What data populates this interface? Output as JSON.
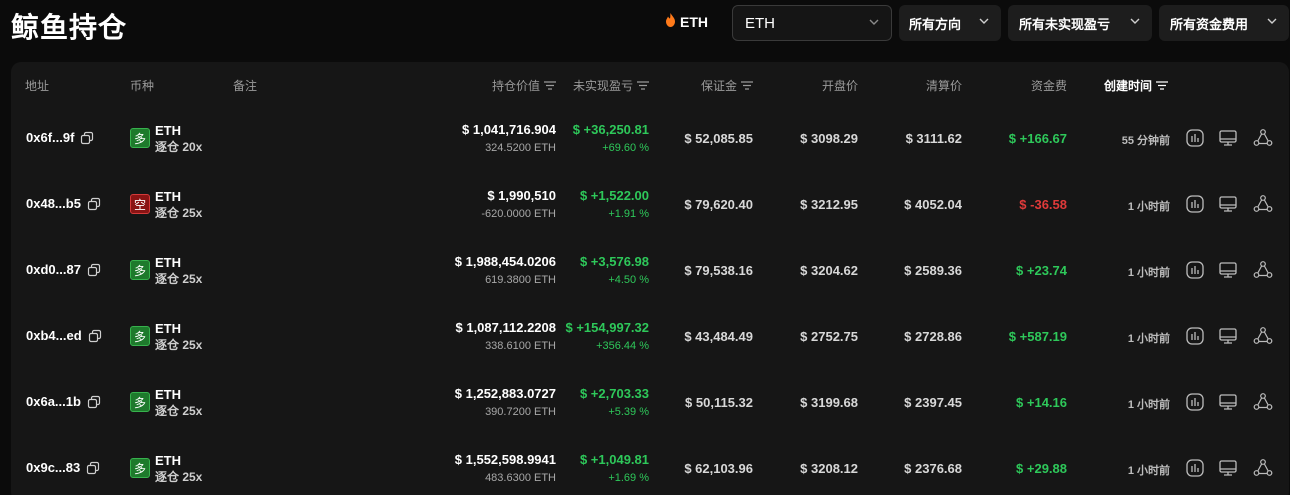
{
  "page": {
    "title": "鲸鱼持仓"
  },
  "filters": {
    "hot_coin": "ETH",
    "coin_select": "ETH",
    "direction": "所有方向",
    "unrealized": "所有未实现盈亏",
    "funding": "所有资金费用"
  },
  "headers": {
    "address": "地址",
    "coin": "币种",
    "note": "备注",
    "position_value": "持仓价值",
    "unrealized_pnl": "未实现盈亏",
    "margin": "保证金",
    "entry_price": "开盘价",
    "liq_price": "清算价",
    "funding_fee": "资金费",
    "created": "创建时间"
  },
  "rows": [
    {
      "address": "0x6f...9f",
      "side": "多",
      "side_type": "long",
      "coin": "ETH",
      "margin_mode": "逐仓 20x",
      "value": "$ 1,041,716.904",
      "size": "324.5200 ETH",
      "pnl": "$ +36,250.81",
      "pnl_pct": "+69.60 %",
      "pnl_sign": "pos",
      "margin": "$ 52,085.85",
      "entry": "$ 3098.29",
      "liq": "$ 3111.62",
      "funding": "$ +166.67",
      "funding_sign": "pos",
      "time": "55 分钟前"
    },
    {
      "address": "0x48...b5",
      "side": "空",
      "side_type": "short",
      "coin": "ETH",
      "margin_mode": "逐仓 25x",
      "value": "$ 1,990,510",
      "size": "-620.0000 ETH",
      "pnl": "$ +1,522.00",
      "pnl_pct": "+1.91 %",
      "pnl_sign": "pos",
      "margin": "$ 79,620.40",
      "entry": "$ 3212.95",
      "liq": "$ 4052.04",
      "funding": "$ -36.58",
      "funding_sign": "neg",
      "time": "1 小时前"
    },
    {
      "address": "0xd0...87",
      "side": "多",
      "side_type": "long",
      "coin": "ETH",
      "margin_mode": "逐仓 25x",
      "value": "$ 1,988,454.0206",
      "size": "619.3800 ETH",
      "pnl": "$ +3,576.98",
      "pnl_pct": "+4.50 %",
      "pnl_sign": "pos",
      "margin": "$ 79,538.16",
      "entry": "$ 3204.62",
      "liq": "$ 2589.36",
      "funding": "$ +23.74",
      "funding_sign": "pos",
      "time": "1 小时前"
    },
    {
      "address": "0xb4...ed",
      "side": "多",
      "side_type": "long",
      "coin": "ETH",
      "margin_mode": "逐仓 25x",
      "value": "$ 1,087,112.2208",
      "size": "338.6100 ETH",
      "pnl": "$ +154,997.32",
      "pnl_pct": "+356.44 %",
      "pnl_sign": "pos",
      "margin": "$ 43,484.49",
      "entry": "$ 2752.75",
      "liq": "$ 2728.86",
      "funding": "$ +587.19",
      "funding_sign": "pos",
      "time": "1 小时前"
    },
    {
      "address": "0x6a...1b",
      "side": "多",
      "side_type": "long",
      "coin": "ETH",
      "margin_mode": "逐仓 25x",
      "value": "$ 1,252,883.0727",
      "size": "390.7200 ETH",
      "pnl": "$ +2,703.33",
      "pnl_pct": "+5.39 %",
      "pnl_sign": "pos",
      "margin": "$ 50,115.32",
      "entry": "$ 3199.68",
      "liq": "$ 2397.45",
      "funding": "$ +14.16",
      "funding_sign": "pos",
      "time": "1 小时前"
    },
    {
      "address": "0x9c...83",
      "side": "多",
      "side_type": "long",
      "coin": "ETH",
      "margin_mode": "逐仓 25x",
      "value": "$ 1,552,598.9941",
      "size": "483.6300 ETH",
      "pnl": "$ +1,049.81",
      "pnl_pct": "+1.69 %",
      "pnl_sign": "pos",
      "margin": "$ 62,103.96",
      "entry": "$ 3208.12",
      "liq": "$ 2376.68",
      "funding": "$ +29.88",
      "funding_sign": "pos",
      "time": "1 小时前"
    }
  ],
  "icons": {
    "copy": "copy-icon",
    "chart": "chart-icon",
    "monitor": "monitor-icon",
    "share": "share-icon",
    "fire": "fire-icon",
    "sort": "sort-icon",
    "chevron": "chevron-down-icon"
  },
  "colors": {
    "positive": "#2ec85a",
    "negative": "#e03a3a",
    "long_badge": "#1e7a2c",
    "short_badge": "#8a1414"
  }
}
